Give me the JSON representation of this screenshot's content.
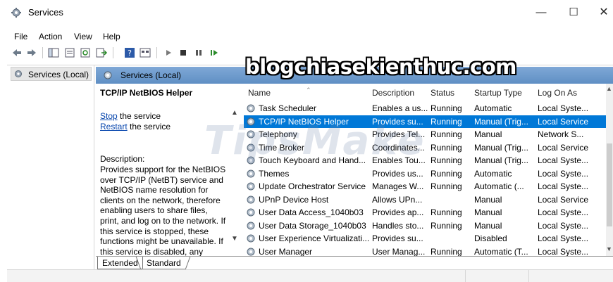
{
  "window": {
    "title": "Services",
    "minimize_icon": "minimize-icon",
    "maximize_icon": "maximize-icon",
    "close_icon": "close-icon"
  },
  "menu": [
    "File",
    "Action",
    "View",
    "Help"
  ],
  "toolbar": [
    "back-arrow-icon",
    "forward-arrow-icon",
    "show-hide-tree-icon",
    "properties-icon",
    "refresh-icon",
    "export-icon",
    "help-icon",
    "console-view-icon",
    "play-icon",
    "stop-icon",
    "pause-icon",
    "restart-icon"
  ],
  "tree": {
    "item": "Services (Local)"
  },
  "header": {
    "title": "Services (Local)"
  },
  "details": {
    "service_name": "TCP/IP NetBIOS Helper",
    "stop_link": "Stop",
    "stop_rest": " the service",
    "restart_link": "Restart",
    "restart_rest": " the service",
    "description_label": "Description:",
    "description": "Provides support for the NetBIOS over TCP/IP (NetBT) service and NetBIOS name resolution for clients on the network, therefore enabling users to share files, print, and log on to the network. If this service is stopped, these functions might be unavailable. If this service is disabled, any services"
  },
  "columns": [
    "Name",
    "Description",
    "Status",
    "Startup Type",
    "Log On As"
  ],
  "services": [
    {
      "name": "Task Scheduler",
      "desc": "Enables a us...",
      "status": "Running",
      "startup": "Automatic",
      "logon": "Local Syste..."
    },
    {
      "name": "TCP/IP NetBIOS Helper",
      "desc": "Provides su...",
      "status": "Running",
      "startup": "Manual (Trig...",
      "logon": "Local Service",
      "selected": true
    },
    {
      "name": "Telephony",
      "desc": "Provides Tel...",
      "status": "Running",
      "startup": "Manual",
      "logon": "Network S..."
    },
    {
      "name": "Time Broker",
      "desc": "Coordinates...",
      "status": "Running",
      "startup": "Manual (Trig...",
      "logon": "Local Service"
    },
    {
      "name": "Touch Keyboard and Hand...",
      "desc": "Enables Tou...",
      "status": "Running",
      "startup": "Manual (Trig...",
      "logon": "Local Syste..."
    },
    {
      "name": "Themes",
      "desc": "Provides us...",
      "status": "Running",
      "startup": "Automatic",
      "logon": "Local Syste..."
    },
    {
      "name": "Update Orchestrator Service",
      "desc": "Manages W...",
      "status": "Running",
      "startup": "Automatic (...",
      "logon": "Local Syste..."
    },
    {
      "name": "UPnP Device Host",
      "desc": "Allows UPn...",
      "status": "",
      "startup": "Manual",
      "logon": "Local Service"
    },
    {
      "name": "User Data Access_1040b03",
      "desc": "Provides ap...",
      "status": "Running",
      "startup": "Manual",
      "logon": "Local Syste..."
    },
    {
      "name": "User Data Storage_1040b03",
      "desc": "Handles sto...",
      "status": "Running",
      "startup": "Manual",
      "logon": "Local Syste..."
    },
    {
      "name": "User Experience Virtualizati...",
      "desc": "Provides su...",
      "status": "",
      "startup": "Disabled",
      "logon": "Local Syste..."
    },
    {
      "name": "User Manager",
      "desc": "User Manag...",
      "status": "Running",
      "startup": "Automatic (T...",
      "logon": "Local Syste..."
    }
  ],
  "tabs": [
    "Extended",
    "Standard"
  ],
  "watermarks": [
    "blogchiasekienthuc.com",
    "TipsMake"
  ]
}
